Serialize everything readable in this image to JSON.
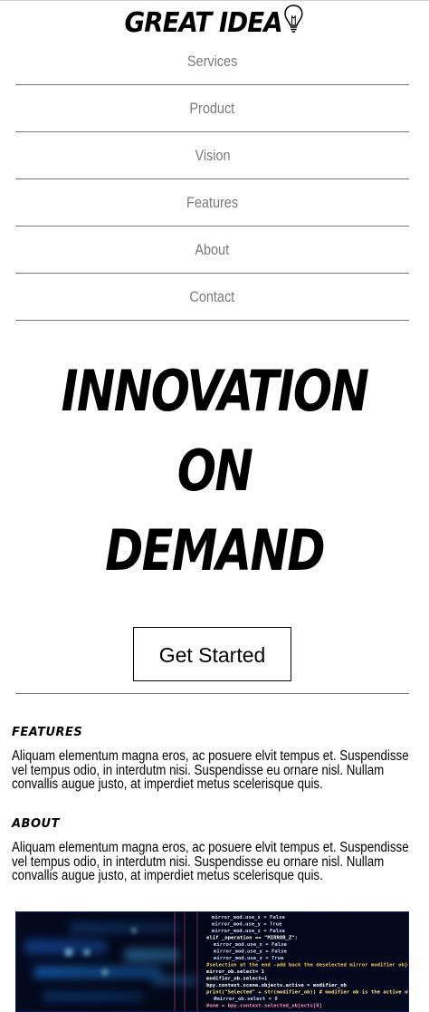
{
  "logo": {
    "text": "GREAT IDEA",
    "icon": "lightbulb-icon"
  },
  "nav": {
    "items": [
      "Services",
      "Product",
      "Vision",
      "Features",
      "About",
      "Contact"
    ]
  },
  "hero": {
    "lines": [
      "INNOVATION",
      "ON",
      "DEMAND"
    ]
  },
  "cta": {
    "label": "Get Started"
  },
  "sections": [
    {
      "title": "FEATURES",
      "body": "Aliquam elementum magna eros, ac posuere elvit tempus et. Suspendisse vel tempus odio, in interdutm nisi. Suspendisse eu ornare nisl. Nullam convallis augue justo, at imperdiet metus scelerisque quis."
    },
    {
      "title": "ABOUT",
      "body": "Aliquam elementum magna eros, ac posuere elvit tempus et. Suspendisse vel tempus odio, in interdutm nisi. Suspendisse eu ornare nisl. Nullam convallis augue justo, at imperdiet metus scelerisque quis."
    }
  ],
  "code_image": {
    "lines": [
      "mirror_mod.use_x = False",
      "mirror_mod.use_y = True",
      "mirror_mod.use_z = False",
      "elif _operation == \"MIRROR_Z\":",
      "  mirror_mod.use_x = False",
      "  mirror_mod.use_y = False",
      "  mirror_mod.use_z = True",
      "#selection at the end -add back the deselected mirror modifier object",
      "mirror_ob.select= 1",
      "modifier_ob.select=1",
      "bpy.context.scene.objects.active = modifier_ob",
      "print(\"Selected\" + str(modifier_ob)) # modifier ob is the active ob",
      "  #mirror_ob.select = 0",
      "#one = bpy.context.selected_objects[0]"
    ]
  },
  "colors": {
    "nav_text": "#7a7a7a",
    "divider": "#777777",
    "code_bg": "#050a1e",
    "code_glow": "#1e8cff"
  }
}
